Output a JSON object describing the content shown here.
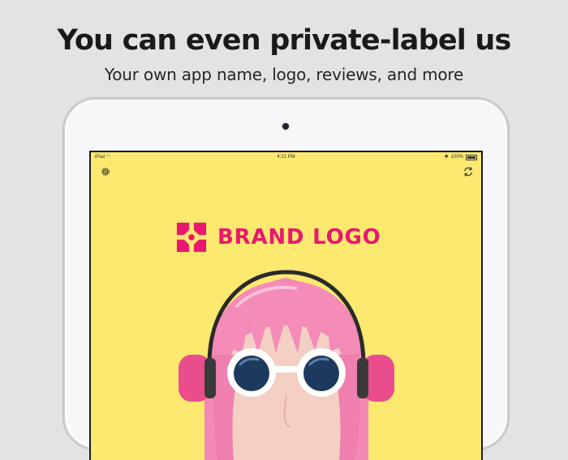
{
  "headline": "You can even private-label us",
  "subheadline": "Your own app name, logo, reviews, and more",
  "device": {
    "status_bar": {
      "carrier": "iPad",
      "time": "4:21 PM",
      "battery": "100%"
    },
    "toolbar": {
      "left_icon": "gear-icon",
      "right_icon": "refresh-icon"
    },
    "brand": {
      "logo_text": "BRAND LOGO",
      "logo_icon": "flower-logo-icon",
      "color": "#e8186e"
    },
    "screen_background": "#fde870"
  },
  "colors": {
    "page_background": "#e3e3e3",
    "hair": "#f48bb8",
    "headphones": "#ea4d8e",
    "glasses_frame": "#ffffff",
    "lens": "#1c3a5e"
  }
}
